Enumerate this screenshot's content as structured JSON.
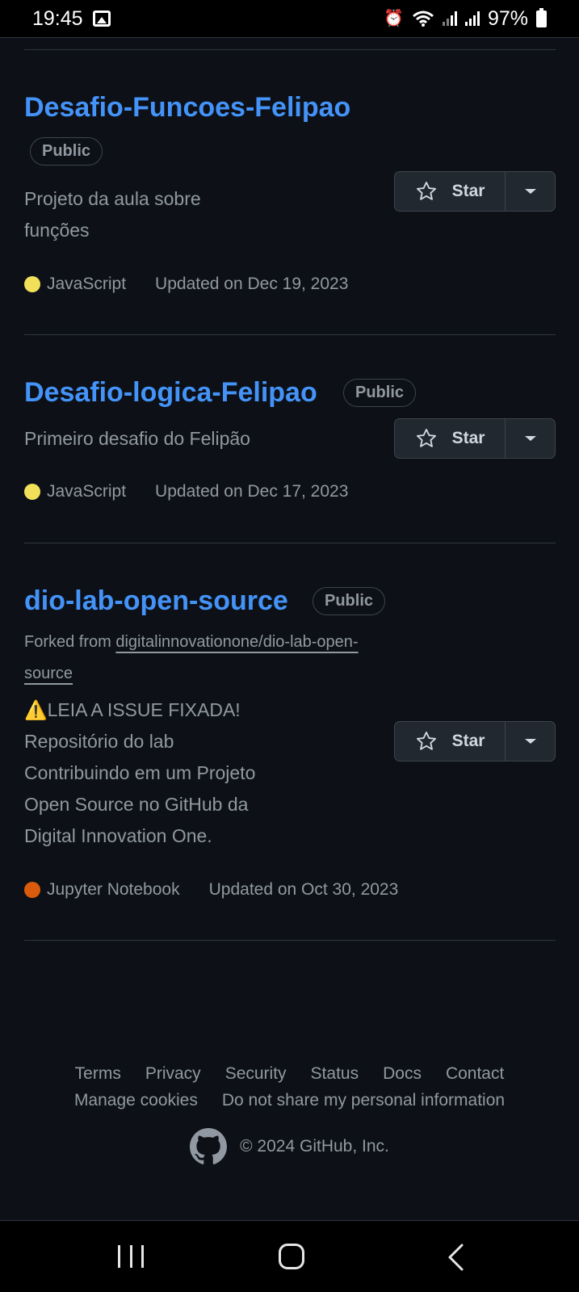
{
  "status_bar": {
    "time": "19:45",
    "battery": "97%",
    "icons": [
      "gallery-icon",
      "alarm-icon",
      "wifi-icon",
      "signal-icon",
      "signal-icon",
      "battery-icon"
    ]
  },
  "repos": [
    {
      "name": "Desafio-Funcoes-Felipao",
      "visibility": "Public",
      "description_lines": [
        "Projeto da aula sobre",
        "funções"
      ],
      "language": "JavaScript",
      "language_color": "#f1e05a",
      "updated": "Updated on Dec 19, 2023",
      "star_label": "Star"
    },
    {
      "name": "Desafio-logica-Felipao",
      "visibility": "Public",
      "description_lines": [
        "Primeiro desafio do Felipão"
      ],
      "language": "JavaScript",
      "language_color": "#f1e05a",
      "updated": "Updated on Dec 17, 2023",
      "star_label": "Star"
    },
    {
      "name": "dio-lab-open-source",
      "visibility": "Public",
      "forked_prefix": "Forked from ",
      "forked_from_line1": "digitalinnovationone/dio-lab-open-",
      "forked_from_line2": "source",
      "description_lines": [
        "⚠️LEIA A ISSUE FIXADA!",
        "Repositório do lab",
        "Contribuindo em um Projeto",
        "Open Source no GitHub da",
        "Digital Innovation One."
      ],
      "language": "Jupyter Notebook",
      "language_color": "#da5b0b",
      "updated": "Updated on Oct 30, 2023",
      "star_label": "Star"
    }
  ],
  "footer": {
    "links": [
      "Terms",
      "Privacy",
      "Security",
      "Status",
      "Docs",
      "Contact"
    ],
    "links2": [
      "Manage cookies",
      "Do not share my personal information"
    ],
    "copyright": "© 2024 GitHub, Inc."
  },
  "colors": {
    "background": "#0d1117",
    "link": "#4493f8",
    "muted": "#9198a1",
    "border": "#30363d"
  }
}
